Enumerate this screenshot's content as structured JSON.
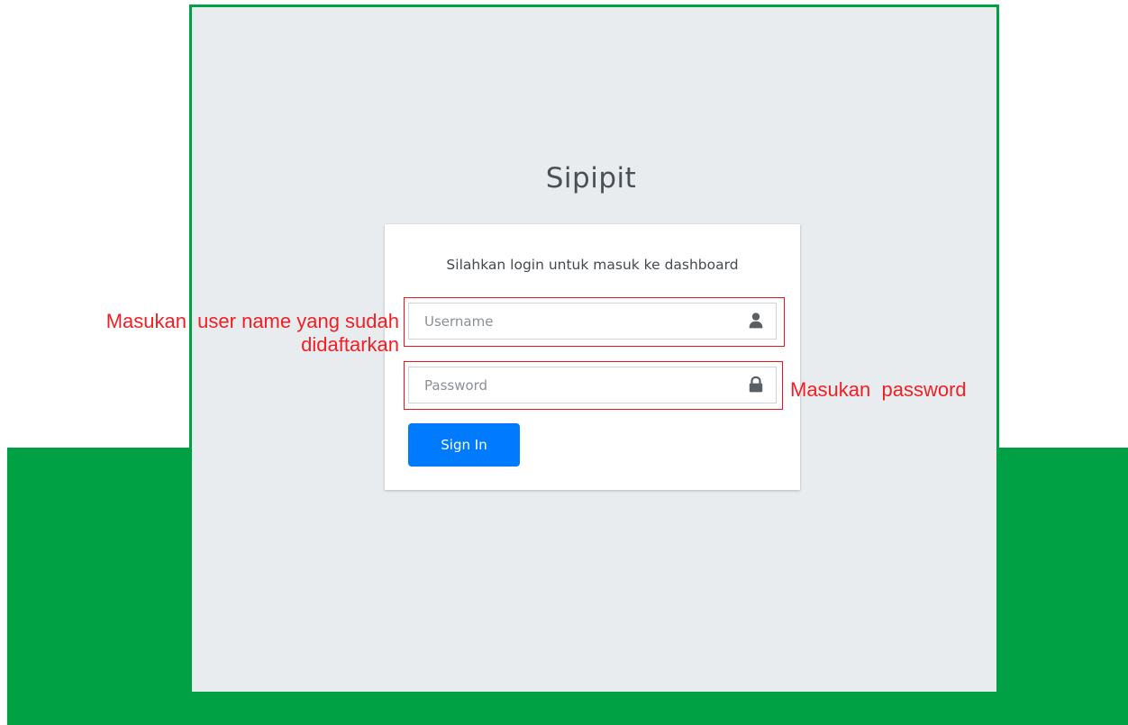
{
  "app": {
    "brand": "Sipipit"
  },
  "login_card": {
    "message": "Silahkan login untuk masuk ke dashboard",
    "username": {
      "placeholder": "Username",
      "value": "",
      "icon": "user-icon"
    },
    "password": {
      "placeholder": "Password",
      "value": "",
      "icon": "lock-icon"
    },
    "signin_label": "Sign In"
  },
  "annotations": {
    "username_note": "Masukan  user name yang sudah\ndidaftarkan",
    "password_note": "Masukan  password",
    "color": "#f02025"
  },
  "colors": {
    "background_green": "#00a145",
    "frame_bg": "#e9ecef",
    "primary_button": "#007bff",
    "highlight_border": "#e3161b"
  }
}
